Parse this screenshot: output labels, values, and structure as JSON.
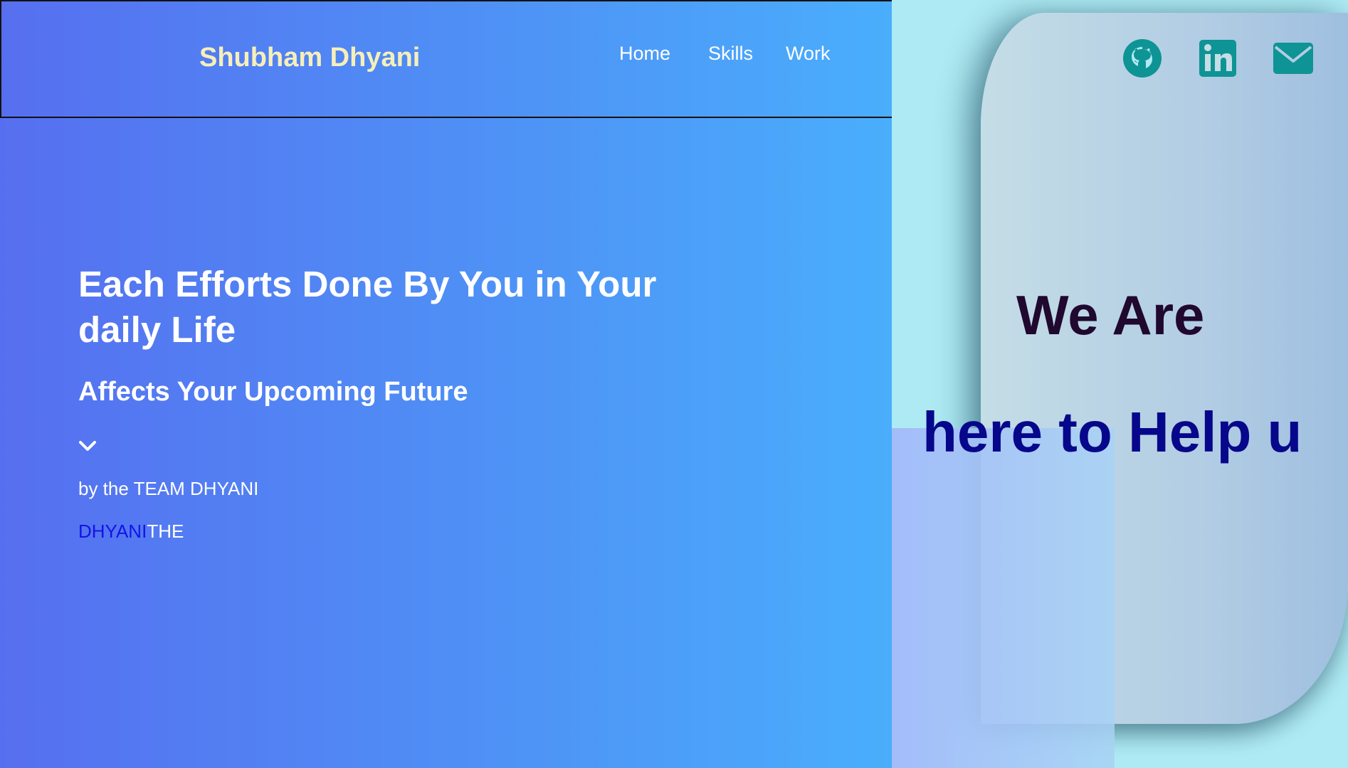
{
  "header": {
    "brand": "Shubham Dhyani",
    "nav": [
      "Home",
      "Skills",
      "Work"
    ]
  },
  "hero": {
    "title": "Each Efforts Done By You in Your daily Life",
    "subtitle": "Affects Your Upcoming Future",
    "byline": "by the TEAM DHYANI",
    "brand_part1": "DHYANI",
    "brand_part2": "THE"
  },
  "side": {
    "heading": "We Are",
    "tagline": "here to Help u"
  },
  "social_icons": [
    "github-icon",
    "linkedin-icon",
    "mail-icon"
  ],
  "colors": {
    "brand_text": "#f6efb9",
    "accent_blue": "#1313e8",
    "heading_dark": "#20082e",
    "tagline_blue": "#07078b",
    "icon_teal": "#0e9494"
  }
}
